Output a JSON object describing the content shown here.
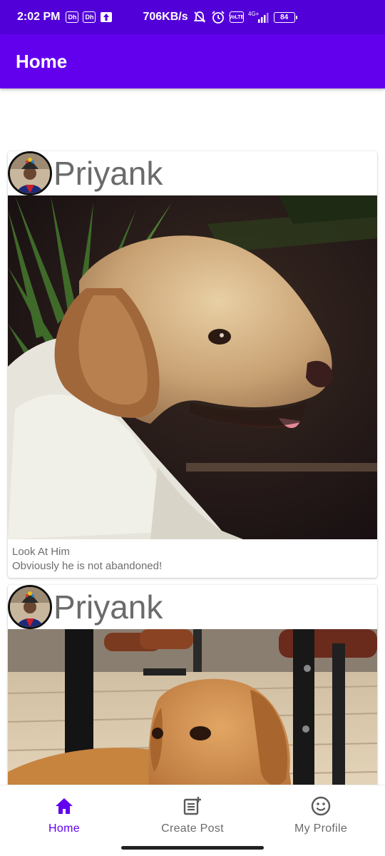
{
  "status_bar": {
    "time": "2:02 PM",
    "badge_1": "Dh",
    "badge_2": "Dh",
    "speed": "706KB/s",
    "volte": "VoLTE",
    "network": "4G+",
    "battery": "84"
  },
  "app_bar": {
    "title": "Home"
  },
  "posts": [
    {
      "author": "Priyank",
      "caption_line1": "Look At Him",
      "caption_line2": "Obviously he is not abandoned!"
    },
    {
      "author": "Priyank"
    }
  ],
  "bottom_nav": {
    "items": [
      {
        "label": "Home",
        "icon": "home-icon",
        "active": true
      },
      {
        "label": "Create Post",
        "icon": "post-add-icon",
        "active": false
      },
      {
        "label": "My Profile",
        "icon": "smiley-face-icon",
        "active": false
      }
    ]
  },
  "colors": {
    "status_bar": "#5200d8",
    "primary": "#6200ee",
    "inactive": "#6b6b6b"
  }
}
